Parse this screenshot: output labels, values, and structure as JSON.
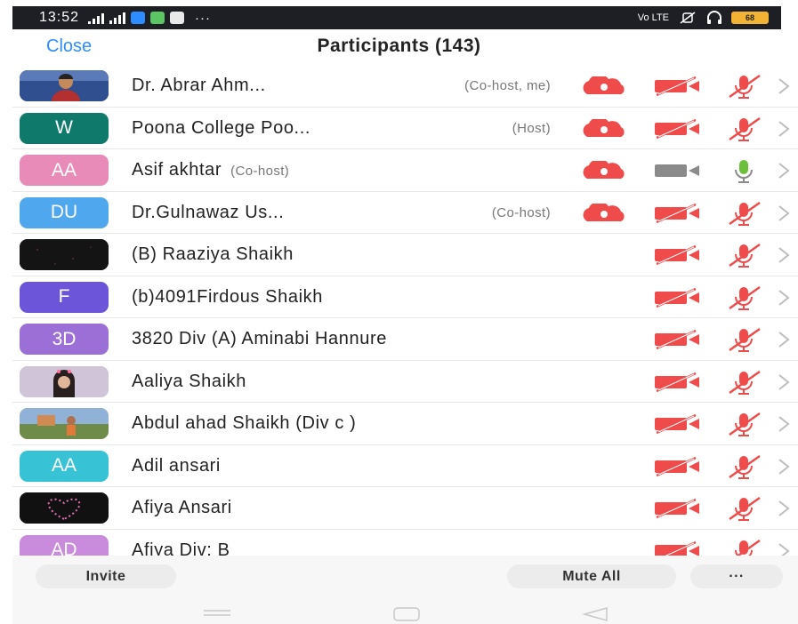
{
  "status_bar": {
    "time": "13:52",
    "dots": "···",
    "volte": "Vo LTE",
    "battery_label": "68"
  },
  "header": {
    "close_label": "Close",
    "title": "Participants (143)"
  },
  "participants": [
    {
      "name": "Dr. Abrar Ahm...",
      "role": "(Co-host, me)",
      "avatar": "",
      "avatar_color": "#2f4f8f",
      "avatar_kind": "photo-man",
      "recording": true,
      "video_on": false,
      "mic_on": false
    },
    {
      "name": "Poona College Poo...",
      "role": "(Host)",
      "avatar": "W",
      "avatar_color": "#0f7a6c",
      "recording": true,
      "video_on": false,
      "mic_on": false
    },
    {
      "name": "Asif akhtar",
      "role": "(Co-host)",
      "avatar": "AA",
      "avatar_color": "#e98bb8",
      "recording": true,
      "video_on": true,
      "mic_on": true
    },
    {
      "name": "Dr.Gulnawaz Us...",
      "role": "(Co-host)",
      "avatar": "DU",
      "avatar_color": "#4fa7ee",
      "recording": true,
      "video_on": false,
      "mic_on": false
    },
    {
      "name": "(B) Raaziya Shaikh",
      "role": "",
      "avatar": "",
      "avatar_color": "#141414",
      "avatar_kind": "photo-dark",
      "recording": false,
      "video_on": false,
      "mic_on": false
    },
    {
      "name": "(b)4091Firdous Shaikh",
      "role": "",
      "avatar": "F",
      "avatar_color": "#6c55d8",
      "recording": false,
      "video_on": false,
      "mic_on": false
    },
    {
      "name": "3820 Div (A) Aminabi Hannure",
      "role": "",
      "avatar": "3D",
      "avatar_color": "#9c6fd6",
      "recording": false,
      "video_on": false,
      "mic_on": false
    },
    {
      "name": "Aaliya Shaikh",
      "role": "",
      "avatar": "",
      "avatar_color": "#b9a8c9",
      "avatar_kind": "photo-girl",
      "recording": false,
      "video_on": false,
      "mic_on": false
    },
    {
      "name": "Abdul ahad Shaikh (Div c )",
      "role": "",
      "avatar": "",
      "avatar_color": "#c87d4e",
      "avatar_kind": "photo-outdoor",
      "recording": false,
      "video_on": false,
      "mic_on": false
    },
    {
      "name": "Adil ansari",
      "role": "",
      "avatar": "AA",
      "avatar_color": "#38c2d6",
      "recording": false,
      "video_on": false,
      "mic_on": false
    },
    {
      "name": "Afiya Ansari",
      "role": "",
      "avatar": "",
      "avatar_color": "#111111",
      "avatar_kind": "photo-heart",
      "recording": false,
      "video_on": false,
      "mic_on": false
    },
    {
      "name": "Afiya Div: B",
      "role": "",
      "avatar": "AD",
      "avatar_color": "#c98bdc",
      "recording": false,
      "video_on": false,
      "mic_on": false
    }
  ],
  "bottom_bar": {
    "invite_label": "Invite",
    "mute_all_label": "Mute All",
    "more_label": "···"
  },
  "colors": {
    "accent": "#2d8cff",
    "muted_red": "#ef4b4b",
    "active_gray": "#8a8a8a",
    "mic_green": "#6bbf3b"
  }
}
